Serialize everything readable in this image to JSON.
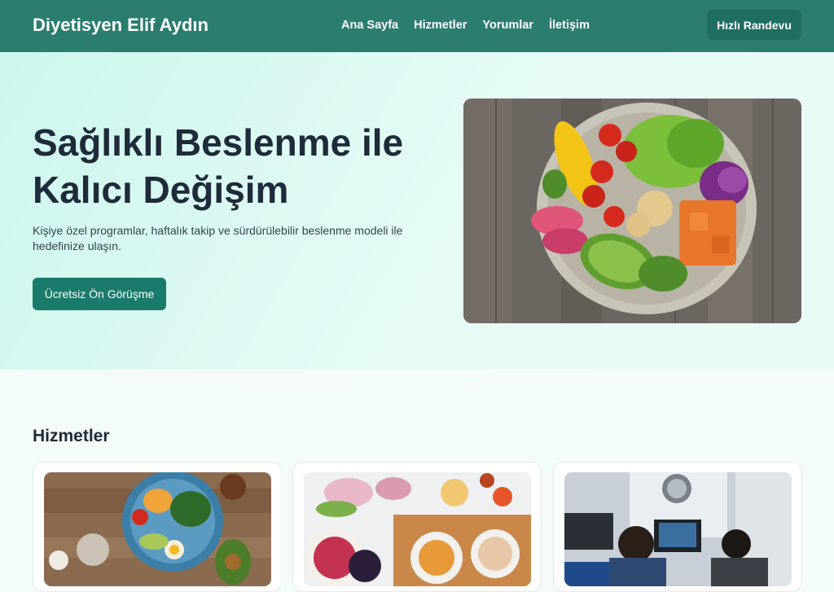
{
  "brand": "Diyetisyen Elif Aydın",
  "nav": {
    "items": [
      "Ana Sayfa",
      "Hizmetler",
      "Yorumlar",
      "İletişim"
    ],
    "cta": "Hızlı Randevu"
  },
  "hero": {
    "title": "Sağlıklı Beslenme ile Kalıcı Değişim",
    "subtitle": "Kişiye özel programlar, haftalık takip ve sürdürülebilir beslenme modeli ile hedefinize ulaşın.",
    "button": "Ücretsiz Ön Görüşme"
  },
  "services": {
    "title": "Hizmetler"
  },
  "colors": {
    "primary": "#2a7d6f",
    "button": "#1a7a6c",
    "heading": "#1f2a3a"
  }
}
